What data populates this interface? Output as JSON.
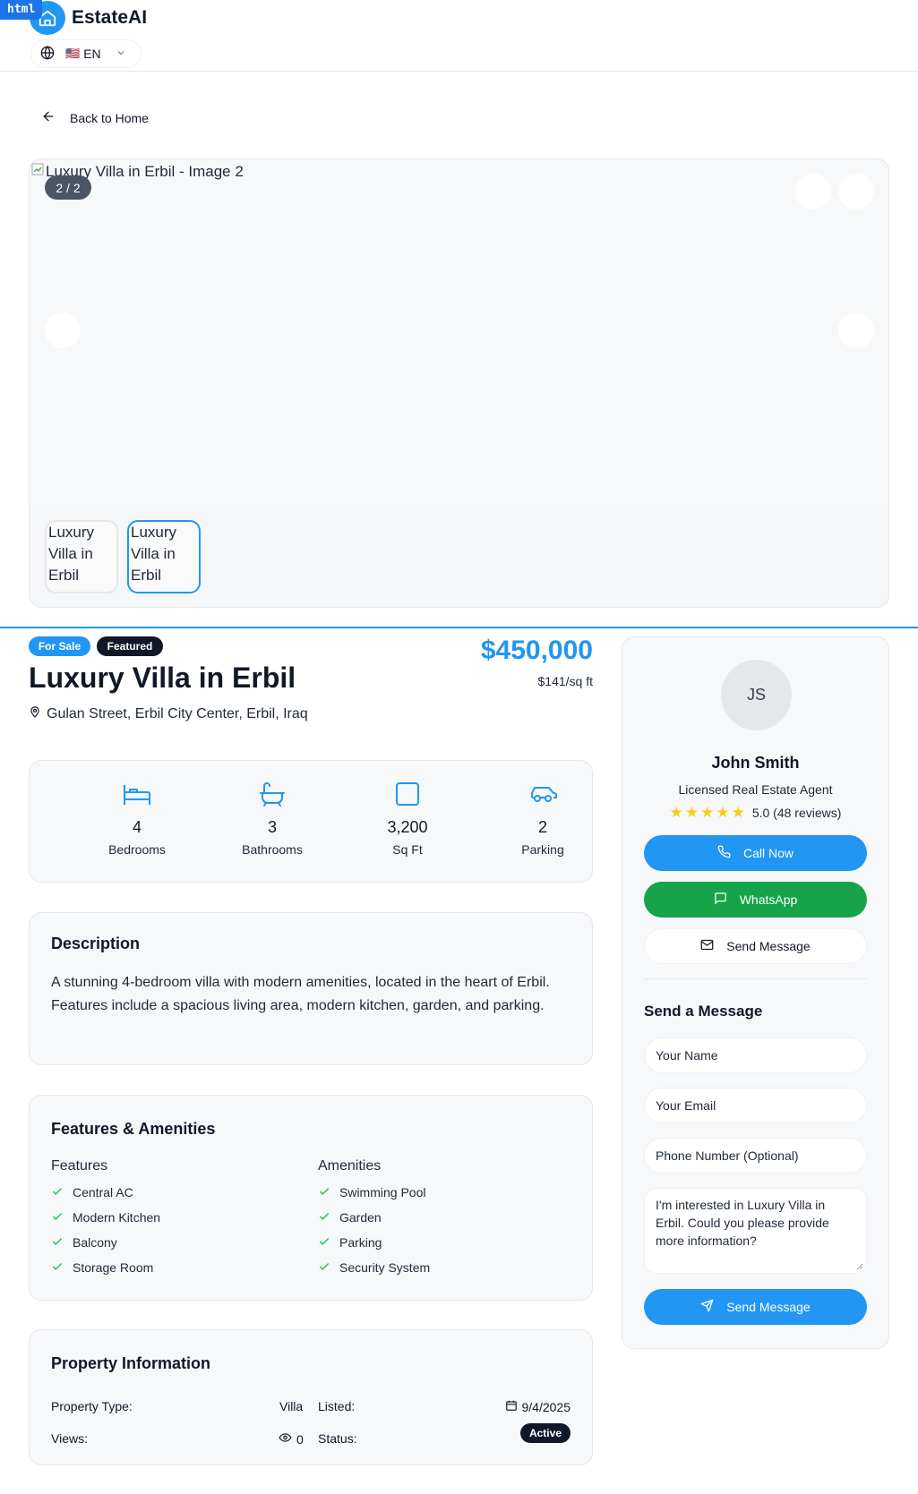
{
  "dev_badge": "html",
  "brand": "EstateAI",
  "language": {
    "flag": "🇺🇸",
    "code": "EN"
  },
  "back_label": "Back to Home",
  "gallery": {
    "main_alt": "Luxury Villa in Erbil - Image 2",
    "counter": "2 / 2",
    "thumbs": [
      "Luxury Villa in Erbil",
      "Luxury Villa in Erbil"
    ]
  },
  "listing": {
    "badge_sale": "For Sale",
    "badge_featured": "Featured",
    "title": "Luxury Villa in Erbil",
    "address": "Gulan Street, Erbil City Center, Erbil, Iraq",
    "price": "$450,000",
    "price_per_sqft": "$141/sq ft"
  },
  "stats": [
    {
      "icon": "bed-icon",
      "value": "4",
      "label": "Bedrooms"
    },
    {
      "icon": "bath-icon",
      "value": "3",
      "label": "Bathrooms"
    },
    {
      "icon": "square-icon",
      "value": "3,200",
      "label": "Sq Ft"
    },
    {
      "icon": "car-icon",
      "value": "2",
      "label": "Parking"
    }
  ],
  "description": {
    "heading": "Description",
    "text": "A stunning 4-bedroom villa with modern amenities, located in the heart of Erbil. Features include a spacious living area, modern kitchen, garden, and parking."
  },
  "features": {
    "heading": "Features & Amenities",
    "features_heading": "Features",
    "features": [
      "Central AC",
      "Modern Kitchen",
      "Balcony",
      "Storage Room"
    ],
    "amenities_heading": "Amenities",
    "amenities": [
      "Swimming Pool",
      "Garden",
      "Parking",
      "Security System"
    ]
  },
  "info": {
    "heading": "Property Information",
    "type_label": "Property Type:",
    "type_value": "Villa",
    "listed_label": "Listed:",
    "listed_value": "9/4/2025",
    "views_label": "Views:",
    "views_value": "0",
    "status_label": "Status:",
    "status_value": "Active"
  },
  "agent": {
    "initials": "JS",
    "name": "John Smith",
    "role": "Licensed Real Estate Agent",
    "rating": "5.0 (48 reviews)",
    "stars": 5,
    "call_label": "Call Now",
    "whatsapp_label": "WhatsApp",
    "message_label": "Send Message"
  },
  "form": {
    "heading": "Send a Message",
    "name_placeholder": "Your Name",
    "email_placeholder": "Your Email",
    "phone_placeholder": "Phone Number (Optional)",
    "message_text": "I'm interested in Luxury Villa in Erbil. Could you please provide more information?",
    "submit_label": "Send Message"
  },
  "colors": {
    "accent": "#2196f3",
    "whatsapp": "#16a34a",
    "check": "#22c55e",
    "star": "#facc15"
  }
}
